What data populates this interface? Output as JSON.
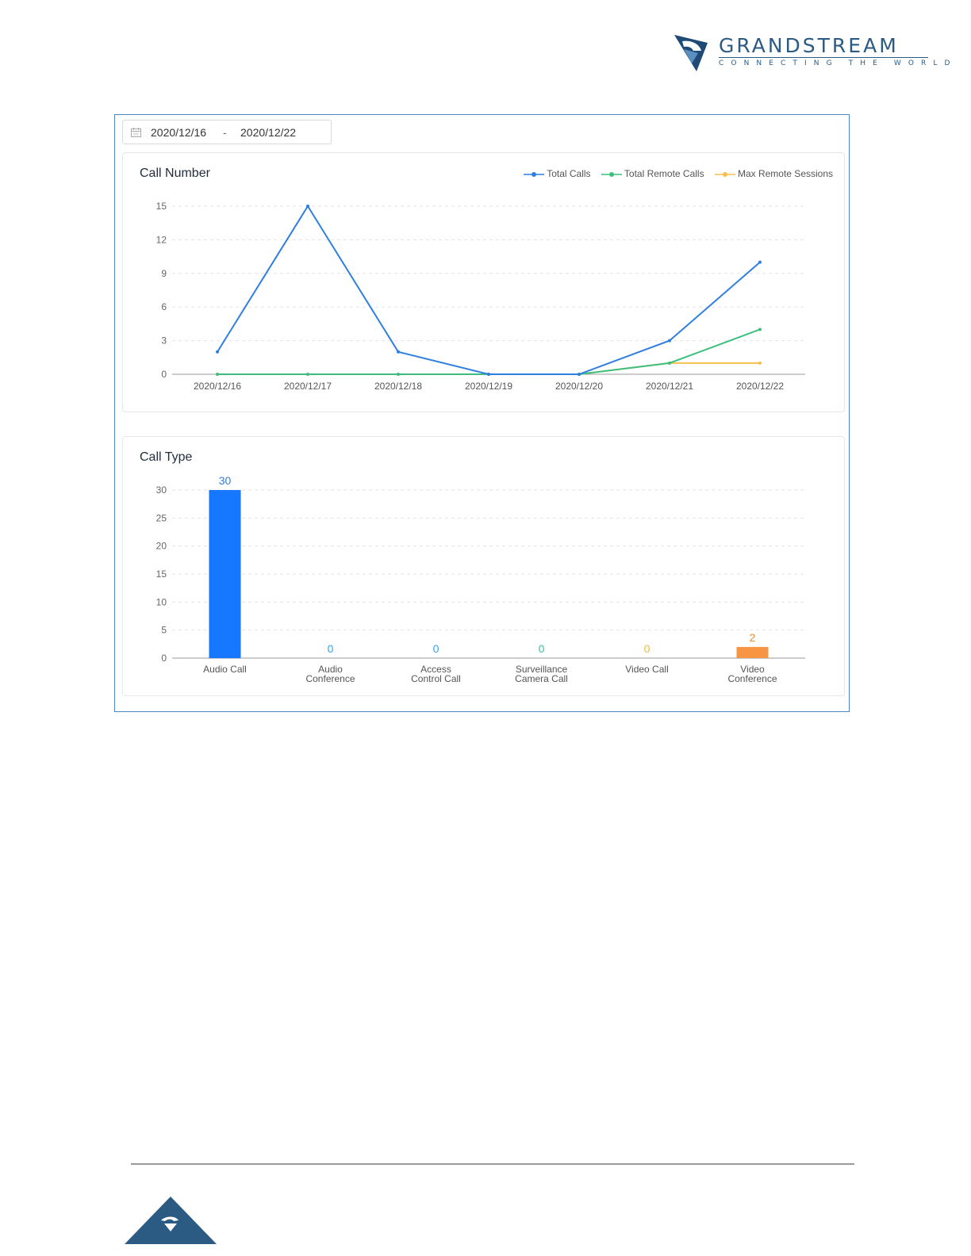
{
  "brand": {
    "name": "GRANDSTREAM",
    "tagline": "CONNECTING THE WORLD",
    "color": "#2b5a83"
  },
  "date_range": {
    "icon": "calendar-icon",
    "start": "2020/12/16",
    "separator": "-",
    "end": "2020/12/22"
  },
  "call_number": {
    "title": "Call Number",
    "legend": [
      "Total Calls",
      "Total Remote Calls",
      "Max Remote Sessions"
    ]
  },
  "call_type": {
    "title": "Call Type"
  },
  "chart_data": [
    {
      "type": "line",
      "title": "Call Number",
      "x": [
        "2020/12/16",
        "2020/12/17",
        "2020/12/18",
        "2020/12/19",
        "2020/12/20",
        "2020/12/21",
        "2020/12/22"
      ],
      "yticks": [
        0,
        3,
        6,
        9,
        12,
        15
      ],
      "ylim": [
        0,
        15
      ],
      "grid": true,
      "legend_position": "top-right",
      "series": [
        {
          "name": "Total Calls",
          "color": "#2f7fe0",
          "values": [
            2,
            15,
            2,
            0,
            0,
            3,
            10
          ]
        },
        {
          "name": "Total Remote Calls",
          "color": "#3fbf7f",
          "values": [
            0,
            0,
            0,
            0,
            0,
            1,
            4
          ]
        },
        {
          "name": "Max Remote Sessions",
          "color": "#f6c04a",
          "values": [
            0,
            0,
            0,
            0,
            0,
            1,
            1
          ]
        }
      ]
    },
    {
      "type": "bar",
      "title": "Call Type",
      "categories": [
        [
          "Audio Call"
        ],
        [
          "Audio",
          "Conference"
        ],
        [
          "Access",
          "Control Call"
        ],
        [
          "Surveillance",
          "Camera Call"
        ],
        [
          "Video Call"
        ],
        [
          "Video",
          "Conference"
        ]
      ],
      "values": [
        30,
        0,
        0,
        0,
        0,
        2
      ],
      "colors": [
        "#1677ff",
        "#36a3f7",
        "#36a3f7",
        "#3fbf9f",
        "#f6c04a",
        "#f89542"
      ],
      "label_colors": [
        "#2f7fe0",
        "#36a3f7",
        "#36a3f7",
        "#3fbf9f",
        "#f6b73c",
        "#f08a32"
      ],
      "yticks": [
        0,
        5,
        10,
        15,
        20,
        25,
        30
      ],
      "ylim": [
        0,
        30
      ],
      "grid": true
    }
  ]
}
